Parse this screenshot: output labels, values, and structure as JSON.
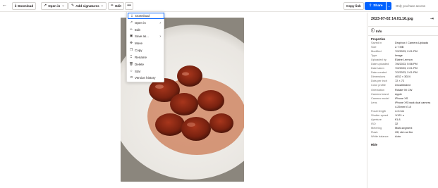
{
  "toolbar": {
    "download_label": "Download",
    "open_in_label": "Open in",
    "add_signatures_label": "Add signatures",
    "edit_label": "Edit",
    "copy_link_label": "Copy link",
    "share_label": "Share",
    "access_text": "Only you have access"
  },
  "menu": {
    "items": [
      {
        "label": "Download",
        "icon": "download-icon",
        "has_submenu": false
      },
      {
        "label": "Open in",
        "icon": "open-in-icon",
        "has_submenu": true
      },
      {
        "label": "Edit",
        "icon": "edit-icon",
        "has_submenu": false
      },
      {
        "label": "Save as...",
        "icon": "save-as-icon",
        "has_submenu": true
      },
      {
        "label": "Move",
        "icon": "move-icon",
        "has_submenu": false
      },
      {
        "label": "Copy",
        "icon": "copy-icon",
        "has_submenu": false
      },
      {
        "label": "Rename",
        "icon": "rename-icon",
        "has_submenu": false
      },
      {
        "label": "Delete",
        "icon": "trash-icon",
        "has_submenu": false
      },
      {
        "label": "Star",
        "icon": "star-icon",
        "has_submenu": false
      },
      {
        "label": "Version history",
        "icon": "version-history-icon",
        "has_submenu": false
      }
    ]
  },
  "panel": {
    "file_name": "2023-07-02 14.01.16.jpg",
    "tab_label": "Info",
    "properties_heading": "Properties",
    "hide_label": "Hide",
    "saved_in": {
      "key": "Saved in",
      "folder1": "Dropbox",
      "folder2": "Camera Uploads"
    },
    "properties": [
      {
        "key": "Size",
        "value": "2.7 MB"
      },
      {
        "key": "Modified",
        "value": "7/2/2023, 2:01 PM"
      },
      {
        "key": "Type",
        "value": "Image"
      },
      {
        "key": "Uploaded by",
        "value": "Elaine Lennon"
      },
      {
        "key": "Date uploaded",
        "value": "7/6/2023, 5:56 PM"
      },
      {
        "key": "Date taken",
        "value": "7/2/2023, 2:01 PM"
      },
      {
        "key": "Date created",
        "value": "7/2/2023, 2:01 PM"
      },
      {
        "key": "Dimensions",
        "value": "4032 × 3024"
      },
      {
        "key": "Dots per inch",
        "value": "72 × 72"
      },
      {
        "key": "Color profile",
        "value": "Uncalibrated"
      },
      {
        "key": "Orientation",
        "value": "Rotate 90 CW"
      },
      {
        "key": "Camera brand",
        "value": "Apple"
      },
      {
        "key": "Camera model",
        "value": "iPhone XS"
      },
      {
        "key": "Lens",
        "value": "iPhone XS back dual camera"
      },
      {
        "key": "",
        "value": "4.25mm f/1.8"
      },
      {
        "key": "Focal length",
        "value": "4.3 mm"
      },
      {
        "key": "Shutter speed",
        "value": "1/121 s"
      },
      {
        "key": "Aperture",
        "value": "f/1.8"
      },
      {
        "key": "ISO",
        "value": "32"
      },
      {
        "key": "Metering",
        "value": "Multi-segment"
      },
      {
        "key": "Flash",
        "value": "Off, did not fire"
      },
      {
        "key": "White balance",
        "value": "Auto"
      }
    ]
  },
  "colors": {
    "accent": "#0061fe",
    "border": "#e5e3e0",
    "muted_text": "#6a6764"
  },
  "icons": {
    "back": "back-arrow-icon",
    "download": "download-icon",
    "open_in": "open-in-icon",
    "signature": "signature-icon",
    "edit": "pencil-icon",
    "more": "more-icon",
    "share": "share-icon",
    "close_panel": "collapse-panel-icon",
    "info": "info-icon"
  }
}
